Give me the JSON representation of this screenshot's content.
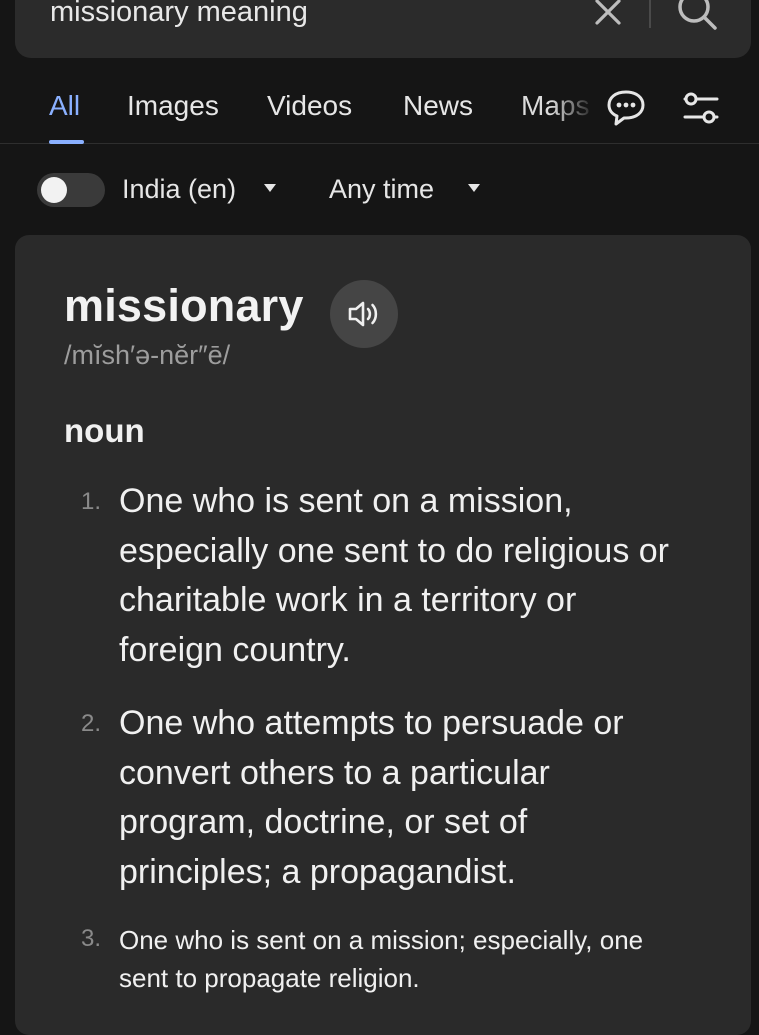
{
  "search": {
    "query": "missionary meaning"
  },
  "tabs": [
    {
      "label": "All",
      "active": true
    },
    {
      "label": "Images",
      "active": false
    },
    {
      "label": "Videos",
      "active": false
    },
    {
      "label": "News",
      "active": false
    },
    {
      "label": "Maps",
      "active": false
    }
  ],
  "filters": {
    "safe_search_on": false,
    "region": "India (en)",
    "time": "Any time"
  },
  "definition": {
    "word": "missionary",
    "pronunciation": "/mĭsh′ə-nĕr″ē/",
    "part_of_speech": "noun",
    "senses": [
      {
        "number": "1.",
        "text": "One who is sent on a mission, especially one sent to do religious or charitable work in a territory or foreign country."
      },
      {
        "number": "2.",
        "text": "One who attempts to persuade or convert others to a particular program, doctrine, or set of principles; a propagandist."
      },
      {
        "number": "3.",
        "text": "One who is sent on a mission; especially, one sent to propagate religion."
      }
    ]
  },
  "colors": {
    "background": "#151515",
    "card": "#2a2a2a",
    "accent": "#8ab0ff",
    "muted_text": "#9d9d9d"
  },
  "icons": [
    "close-icon",
    "search-icon",
    "chat-icon",
    "filter-settings-icon",
    "speaker-icon",
    "caret-down-icon"
  ]
}
